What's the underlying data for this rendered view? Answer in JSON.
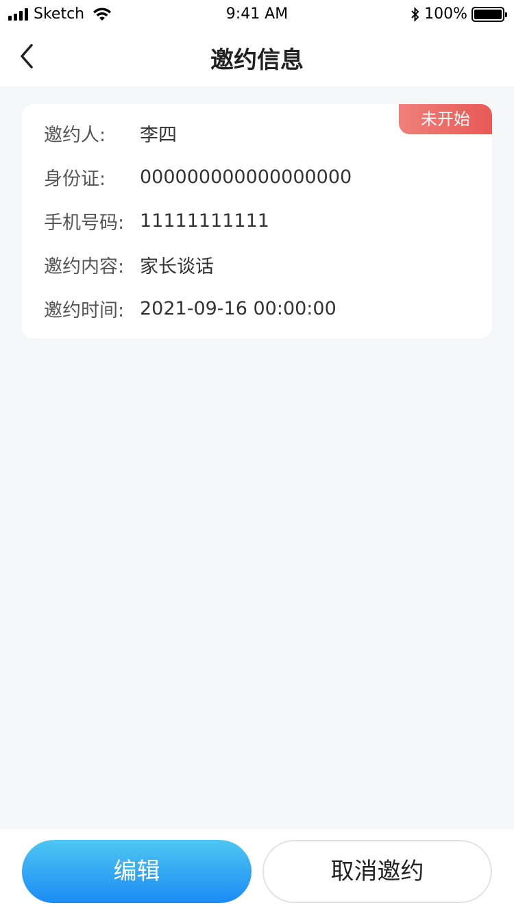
{
  "status_bar": {
    "carrier": "Sketch",
    "time": "9:41 AM",
    "battery_percent": "100%"
  },
  "nav": {
    "title": "邀约信息",
    "back_icon": "chevron-left-icon"
  },
  "invitation": {
    "status_badge": "未开始",
    "status_color": "#e85a55",
    "fields": [
      {
        "label": "邀约人:",
        "value": "李四"
      },
      {
        "label": "身份证:",
        "value": "000000000000000000"
      },
      {
        "label": "手机号码:",
        "value": "11111111111"
      },
      {
        "label": "邀约内容:",
        "value": "家长谈话"
      },
      {
        "label": "邀约时间:",
        "value": "2021-09-16 00:00:00"
      }
    ]
  },
  "actions": {
    "edit_label": "编辑",
    "cancel_label": "取消邀约",
    "primary_color": "#1b8cf5"
  }
}
